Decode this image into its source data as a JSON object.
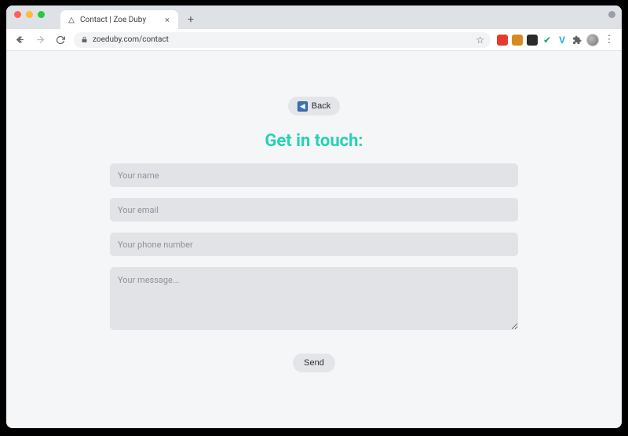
{
  "browser": {
    "tab": {
      "title": "Contact | Zoe Duby",
      "favicon_glyph": "△"
    },
    "url": "zoeduby.com/contact"
  },
  "page": {
    "back_label": "Back",
    "title": "Get in touch:",
    "name": {
      "value": "",
      "placeholder": "Your name"
    },
    "email": {
      "value": "",
      "placeholder": "Your email"
    },
    "phone": {
      "value": "",
      "placeholder": "Your phone number"
    },
    "message": {
      "value": "",
      "placeholder": "Your message..."
    },
    "send_label": "Send"
  },
  "extensions": {
    "vimeo_glyph": "V"
  }
}
